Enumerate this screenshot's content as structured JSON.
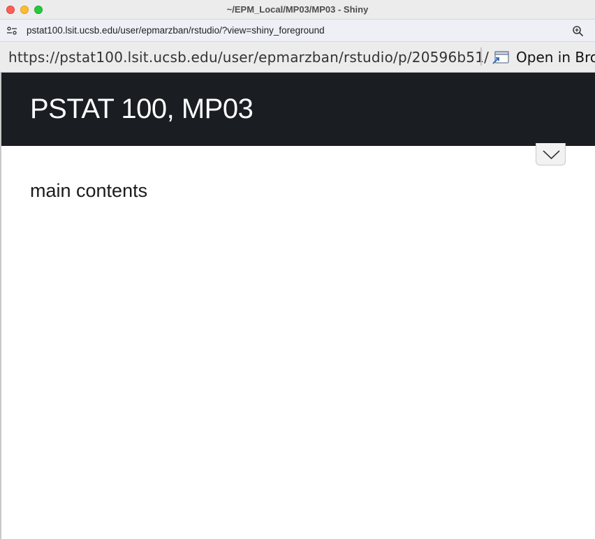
{
  "window": {
    "title": "~/EPM_Local/MP03/MP03 - Shiny"
  },
  "address_bar": {
    "url": "pstat100.lsit.ucsb.edu/user/epmarzban/rstudio/?view=shiny_foreground",
    "site_settings_icon": "tune-icon",
    "zoom_icon": "zoom-in-icon"
  },
  "viewer_toolbar": {
    "url": "https://pstat100.lsit.ucsb.edu/user/epmarzban/rstudio/p/20596b51/",
    "open_in_browser_label": "Open in Brow",
    "open_in_browser_icon": "open-in-browser-icon"
  },
  "app": {
    "title": "PSTAT 100, MP03",
    "navbar_color": "#1a1d21",
    "collapse_icon": "chevron-down-icon",
    "main_text": "main contents"
  }
}
